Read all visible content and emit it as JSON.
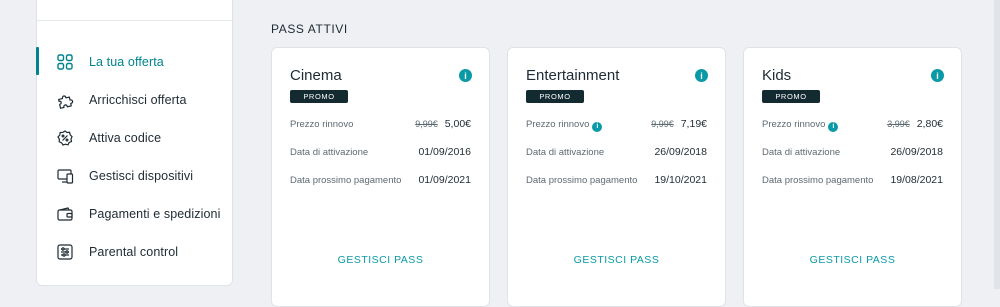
{
  "sidebar": {
    "items": [
      {
        "label": "La tua offerta",
        "icon": "grid-icon",
        "active": true
      },
      {
        "label": "Arricchisci offerta",
        "icon": "puzzle-icon",
        "active": false
      },
      {
        "label": "Attiva codice",
        "icon": "percent-badge-icon",
        "active": false
      },
      {
        "label": "Gestisci dispositivi",
        "icon": "devices-icon",
        "active": false
      },
      {
        "label": "Pagamenti e spedizioni",
        "icon": "wallet-icon",
        "active": false
      },
      {
        "label": "Parental control",
        "icon": "sliders-icon",
        "active": false
      }
    ]
  },
  "main": {
    "section_title": "PASS ATTIVI",
    "labels": {
      "renewal_price": "Prezzo rinnovo",
      "activation_date": "Data di attivazione",
      "next_payment": "Data prossimo pagamento",
      "manage": "GESTISCI PASS",
      "badge": "PROMO",
      "info": "i"
    },
    "cards": [
      {
        "title": "Cinema",
        "old_price": "9,99€",
        "price": "5,00€",
        "activation": "01/09/2016",
        "next_payment": "01/09/2021"
      },
      {
        "title": "Entertainment",
        "old_price": "9,99€",
        "price": "7,19€",
        "activation": "26/09/2018",
        "next_payment": "19/10/2021"
      },
      {
        "title": "Kids",
        "old_price": "3,99€",
        "price": "2,80€",
        "activation": "26/09/2018",
        "next_payment": "19/08/2021"
      }
    ]
  },
  "colors": {
    "accent": "#0a9aa6",
    "active_nav": "#00838f",
    "badge_bg": "#132a30",
    "page_bg": "#eef0f3"
  }
}
